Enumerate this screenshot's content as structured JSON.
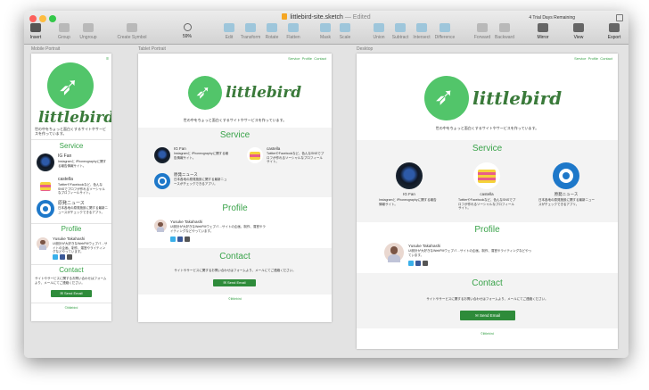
{
  "window": {
    "title": "littlebird-site.sketch",
    "edited": "— Edited",
    "trial": "4 Trial Days Remaining"
  },
  "toolbar": {
    "insert": "Insert",
    "group": "Group",
    "ungroup": "Ungroup",
    "create_symbol": "Create Symbol",
    "zoom": "59%",
    "edit": "Edit",
    "transform": "Transform",
    "rotate": "Rotate",
    "flatten": "Flatten",
    "mask": "Mask",
    "scale": "Scale",
    "union": "Union",
    "subtract": "Subtract",
    "intersect": "Intersect",
    "difference": "Difference",
    "forward": "Forward",
    "backward": "Backward",
    "mirror": "Mirror",
    "view": "View",
    "export": "Export"
  },
  "artboards": {
    "mobile_label": "Mobile Portrait",
    "tablet_label": "Tablet Portrait",
    "desktop_label": "Desktop"
  },
  "site": {
    "nav": "Service  Profile  Contact",
    "logo_text": "littlebird",
    "tagline": "世の中をちょっと面白くするサイトやサービスを作っています。",
    "service_title": "Service",
    "services": [
      {
        "name": "IG Fan",
        "desc": "Instagramと iPhoneographyに関する報告情報サイト。"
      },
      {
        "name": "castella",
        "desc": "TwitterやFacebookなど、色んなSNSでプロフが作れるソーシャルなプロフィールサイト。"
      },
      {
        "name": "原発ニュース",
        "desc": "日本各地の原発施設に関する最新ニュースがチェックできるアプリ。"
      }
    ],
    "profile_title": "Profile",
    "profile_name": "Yusuke Takahashi",
    "profile_desc": "UI設計が大好きなWebPMウェブバ…サイトの企画、制作、運営やライティングなどやっています。",
    "contact_title": "Contact",
    "contact_desc": "サイトやサービスに関するお問い合わせはフォームより、メールにてご連絡ください。",
    "send_email": "Send Email",
    "footer": "©littlebird"
  },
  "colors": {
    "brand_green": "#52c56a",
    "heading_green": "#3aa34a",
    "button_green": "#2e8b3a",
    "canvas_gray": "#e3e3e3"
  }
}
